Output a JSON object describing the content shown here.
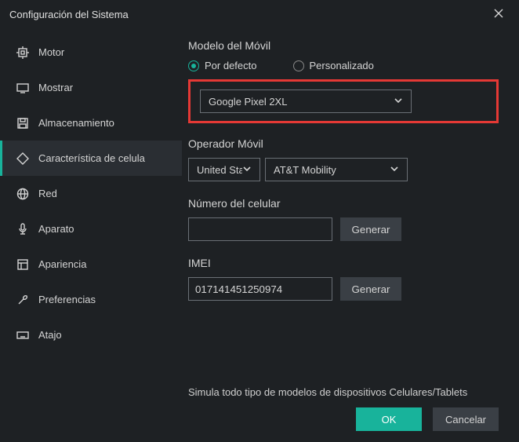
{
  "title": "Configuración del Sistema",
  "sidebar": {
    "items": [
      {
        "label": "Motor"
      },
      {
        "label": "Mostrar"
      },
      {
        "label": "Almacenamiento"
      },
      {
        "label": "Característica de celula"
      },
      {
        "label": "Red"
      },
      {
        "label": "Aparato"
      },
      {
        "label": "Apariencia"
      },
      {
        "label": "Preferencias"
      },
      {
        "label": "Atajo"
      }
    ]
  },
  "main": {
    "model_section": "Modelo del Móvil",
    "radio_default": "Por defecto",
    "radio_custom": "Personalizado",
    "model_value": "Google Pixel 2XL",
    "carrier_section": "Operador Móvil",
    "country_value": "United States",
    "carrier_value": "AT&T Mobility",
    "phone_section": "Número del celular",
    "phone_value": "",
    "imei_section": "IMEI",
    "imei_value": "017141451250974",
    "generate_label": "Generar",
    "description": "Simula todo tipo de modelos de dispositivos Celulares/Tablets"
  },
  "footer": {
    "ok": "OK",
    "cancel": "Cancelar"
  }
}
